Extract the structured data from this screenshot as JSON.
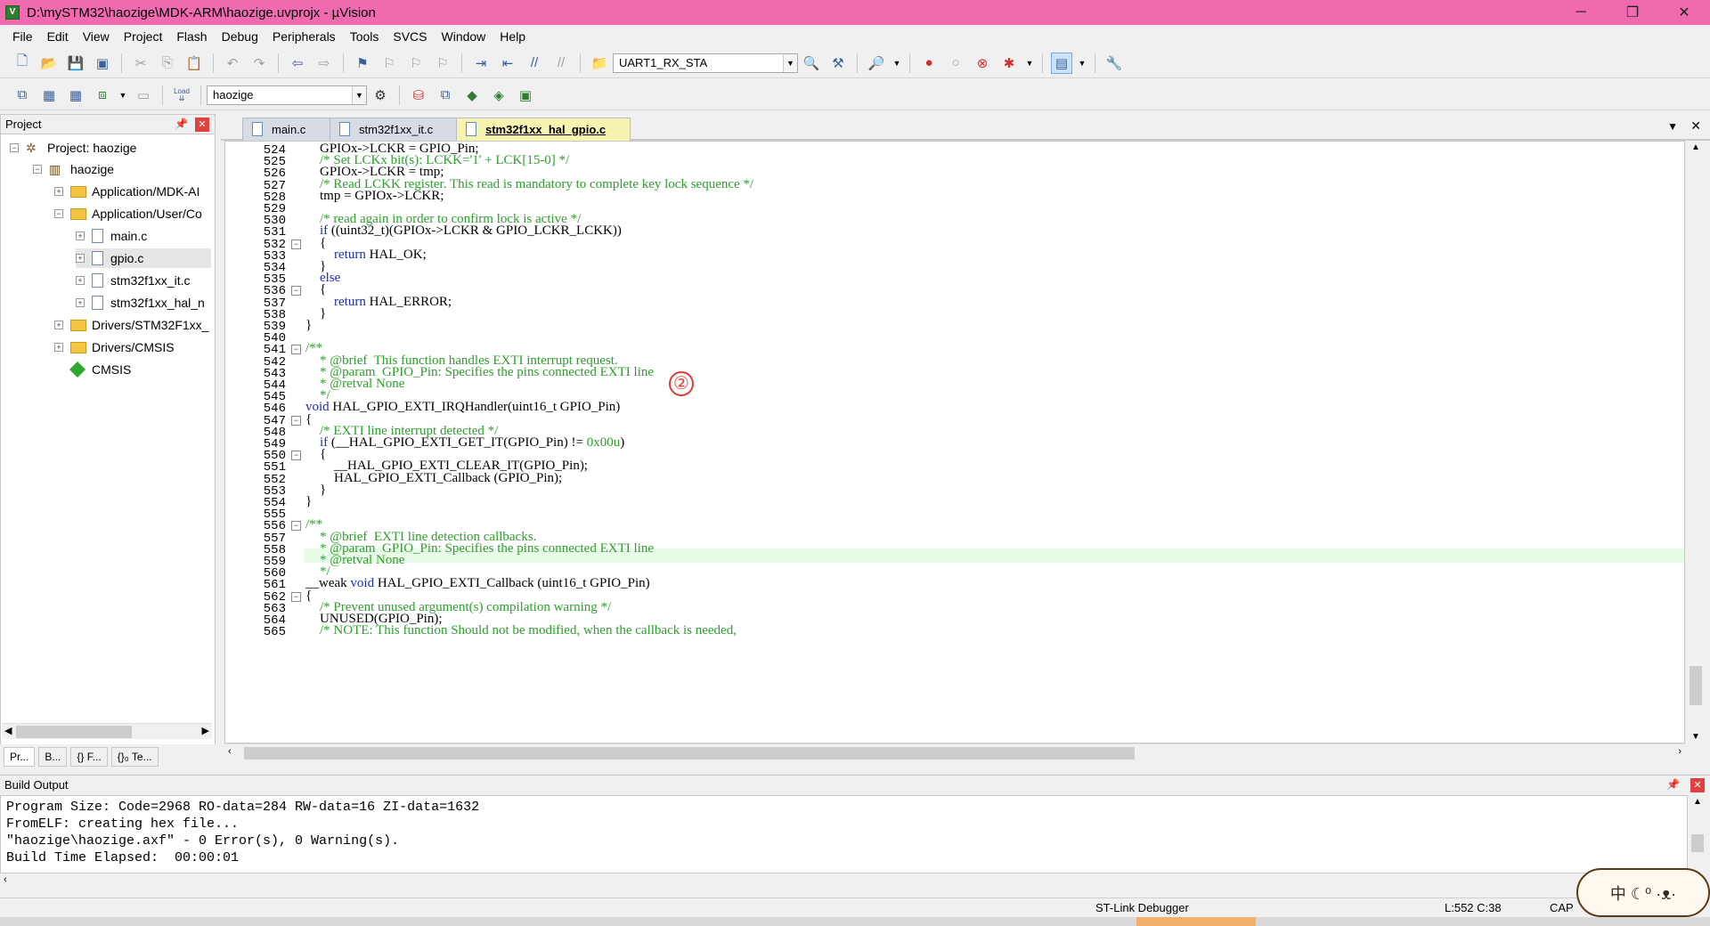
{
  "window": {
    "title": "D:\\mySTM32\\haozige\\MDK-ARM\\haozige.uvprojx - µVision",
    "minimize": "─",
    "restore": "❐",
    "close": "✕"
  },
  "menu": [
    "File",
    "Edit",
    "View",
    "Project",
    "Flash",
    "Debug",
    "Peripherals",
    "Tools",
    "SVCS",
    "Window",
    "Help"
  ],
  "toolbar1": {
    "find_combo": "UART1_RX_STA"
  },
  "toolbar2": {
    "target_combo": "haozige",
    "load_label": "Load"
  },
  "project_panel": {
    "title": "Project",
    "tree": [
      {
        "label": "Project: haozige"
      },
      {
        "label": "haozige"
      },
      {
        "label": "Application/MDK-AI"
      },
      {
        "label": "Application/User/Co"
      },
      {
        "label": "main.c"
      },
      {
        "label": "gpio.c"
      },
      {
        "label": "stm32f1xx_it.c"
      },
      {
        "label": "stm32f1xx_hal_n"
      },
      {
        "label": "Drivers/STM32F1xx_"
      },
      {
        "label": "Drivers/CMSIS"
      },
      {
        "label": "CMSIS"
      }
    ],
    "tabs": [
      "Pr...",
      "B...",
      "{} F...",
      "{}₀ Te..."
    ]
  },
  "editor": {
    "tabs": [
      "main.c",
      "stm32f1xx_it.c",
      "stm32f1xx_hal_gpio.c"
    ],
    "active_tab": "stm32f1xx_hal_gpio.c",
    "annotation_marker": "②",
    "lines": [
      {
        "n": "524",
        "text": "GPIOx->LCKR = GPIO_Pin;"
      },
      {
        "n": "525",
        "text": "/* Set LCKx bit(s): LCKK='1' + LCK[15-0] */"
      },
      {
        "n": "526",
        "text": "GPIOx->LCKR = tmp;"
      },
      {
        "n": "527",
        "text": "/* Read LCKK register. This read is mandatory to complete key lock sequence */"
      },
      {
        "n": "528",
        "text": "tmp = GPIOx->LCKR;"
      },
      {
        "n": "529",
        "text": ""
      },
      {
        "n": "530",
        "text": "/* read again in order to confirm lock is active */"
      },
      {
        "n": "531",
        "text": "if ((uint32_t)(GPIOx->LCKR & GPIO_LCKR_LCKK))"
      },
      {
        "n": "532",
        "text": "{"
      },
      {
        "n": "533",
        "text": "return HAL_OK;"
      },
      {
        "n": "534",
        "text": "}"
      },
      {
        "n": "535",
        "text": "else"
      },
      {
        "n": "536",
        "text": "{"
      },
      {
        "n": "537",
        "text": "return HAL_ERROR;"
      },
      {
        "n": "538",
        "text": "}"
      },
      {
        "n": "539",
        "text": "}"
      },
      {
        "n": "540",
        "text": ""
      },
      {
        "n": "541",
        "text": "/**"
      },
      {
        "n": "542",
        "text": "* @brief  This function handles EXTI interrupt request."
      },
      {
        "n": "543",
        "text": "* @param  GPIO_Pin: Specifies the pins connected EXTI line"
      },
      {
        "n": "544",
        "text": "* @retval None"
      },
      {
        "n": "545",
        "text": "*/"
      },
      {
        "n": "546",
        "text": "void HAL_GPIO_EXTI_IRQHandler(uint16_t GPIO_Pin)"
      },
      {
        "n": "547",
        "text": "{"
      },
      {
        "n": "548",
        "text": "/* EXTI line interrupt detected */"
      },
      {
        "n": "549",
        "text": "if (__HAL_GPIO_EXTI_GET_IT(GPIO_Pin) != 0x00u)"
      },
      {
        "n": "550",
        "text": "{"
      },
      {
        "n": "551",
        "text": "__HAL_GPIO_EXTI_CLEAR_IT(GPIO_Pin);"
      },
      {
        "n": "552",
        "text": "HAL_GPIO_EXTI_Callback (GPIO_Pin);"
      },
      {
        "n": "553",
        "text": "}"
      },
      {
        "n": "554",
        "text": "}"
      },
      {
        "n": "555",
        "text": ""
      },
      {
        "n": "556",
        "text": "/**"
      },
      {
        "n": "557",
        "text": "* @brief  EXTI line detection callbacks."
      },
      {
        "n": "558",
        "text": "* @param  GPIO_Pin: Specifies the pins connected EXTI line"
      },
      {
        "n": "559",
        "text": "* @retval None"
      },
      {
        "n": "560",
        "text": "*/"
      },
      {
        "n": "561",
        "text": "__weak void HAL_GPIO_EXTI_Callback (uint16_t GPIO_Pin)"
      },
      {
        "n": "562",
        "text": "{"
      },
      {
        "n": "563",
        "text": "/* Prevent unused argument(s) compilation warning */"
      },
      {
        "n": "564",
        "text": "UNUSED(GPIO_Pin);"
      },
      {
        "n": "565",
        "text": "/* NOTE: This function Should not be modified, when the callback is needed,"
      }
    ]
  },
  "build_output": {
    "title": "Build Output",
    "lines": [
      "Program Size: Code=2968 RO-data=284 RW-data=16 ZI-data=1632",
      "FromELF: creating hex file...",
      "\"haozige\\haozige.axf\" - 0 Error(s), 0 Warning(s).",
      "Build Time Elapsed:  00:00:01"
    ]
  },
  "statusbar": {
    "debugger": "ST-Link Debugger",
    "position": "L:552 C:38",
    "caps": "CAP"
  },
  "colors": {
    "titlebar": "#f06ab0",
    "keyword": "#1e2eb0",
    "comment": "#2e9e2e",
    "current_line": "#e8fbe8",
    "active_tab": "#f7f3b0"
  }
}
